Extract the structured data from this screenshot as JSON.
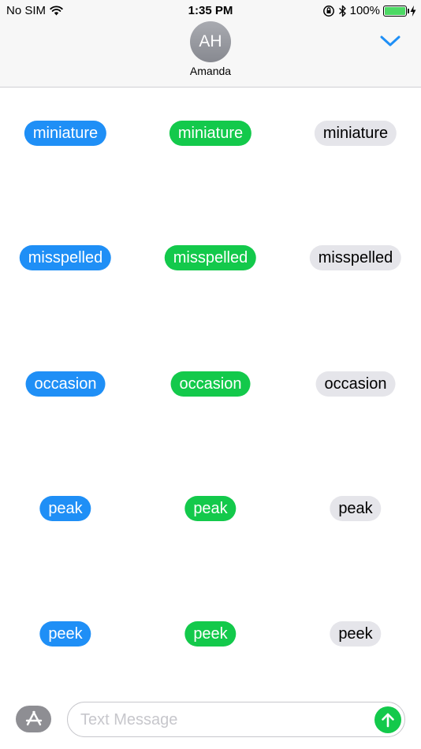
{
  "status_bar": {
    "carrier": "No SIM",
    "time": "1:35 PM",
    "battery_percent": "100%",
    "battery_level": 1.0,
    "icons": [
      "wifi-icon",
      "orientation-lock-icon",
      "bluetooth-icon",
      "battery-icon",
      "charging-bolt-icon"
    ]
  },
  "header": {
    "contact_initials": "AH",
    "contact_name": "Amanda",
    "details_icon": "chevron-down-icon",
    "accent_color": "#1f8ff6"
  },
  "colors": {
    "blue_bubble": "#1f8ff6",
    "green_bubble": "#13c94b",
    "gray_bubble": "#e5e5ea"
  },
  "rows": [
    {
      "word": "miniature",
      "blue": "miniature",
      "green": "miniature",
      "gray": "miniature"
    },
    {
      "word": "misspelled",
      "blue": "misspelled",
      "green": "misspelled",
      "gray": "misspelled"
    },
    {
      "word": "occasion",
      "blue": "occasion",
      "green": "occasion",
      "gray": "occasion"
    },
    {
      "word": "peak",
      "blue": "peak",
      "green": "peak",
      "gray": "peak"
    },
    {
      "word": "peek",
      "blue": "peek",
      "green": "peek",
      "gray": "peek"
    }
  ],
  "input_bar": {
    "placeholder": "Text Message",
    "value": "",
    "apps_icon": "app-store-icon",
    "send_icon": "send-arrow-up-icon"
  }
}
